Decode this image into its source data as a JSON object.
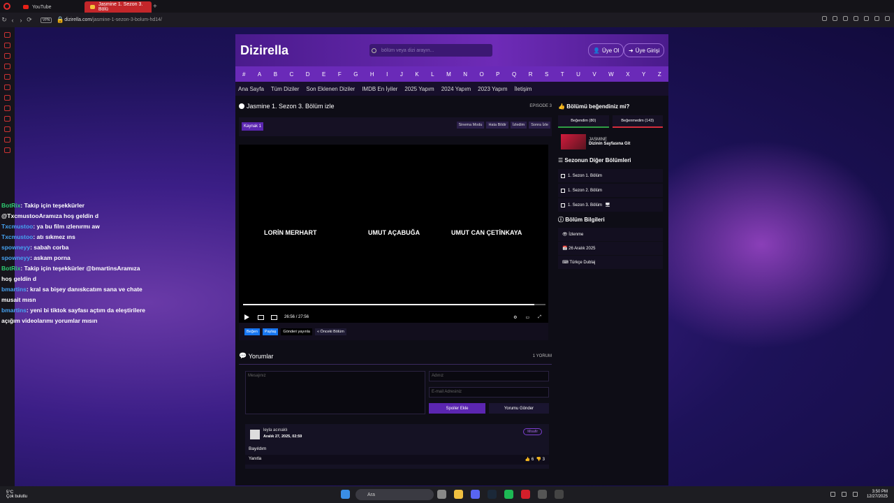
{
  "browser": {
    "tabs": [
      {
        "title": "YouTube"
      },
      {
        "title": "Jasmine 1. Sezon 3. Bölü"
      }
    ],
    "url_domain": "dizirella.com",
    "url_path": "/jasmine-1-sezon-3-bolum-hd14/",
    "vpn": "VPN"
  },
  "site": {
    "logo": "Dizirella",
    "search_placeholder": "bölüm veya dizi arayın...",
    "register": "Üye Ol",
    "login": "Üye Girişi",
    "alphabet": [
      "#",
      "A",
      "B",
      "C",
      "D",
      "E",
      "F",
      "G",
      "H",
      "I",
      "J",
      "K",
      "L",
      "M",
      "N",
      "O",
      "P",
      "Q",
      "R",
      "S",
      "T",
      "U",
      "V",
      "W",
      "X",
      "Y",
      "Z"
    ],
    "menu": [
      "Ana Sayfa",
      "Tüm Diziler",
      "Son Eklenen Diziler",
      "IMDB En İyiler",
      "2025 Yapım",
      "2024 Yapım",
      "2023 Yapım",
      "İletişim"
    ]
  },
  "episode": {
    "title": "Jasmine 1. Sezon 3. Bölüm izle",
    "label": "EPISODE 3",
    "source": "Kaynak 1",
    "buttons": [
      "Sinema Modu",
      "Hata Bildir",
      "İzledim",
      "Sonra İzle"
    ]
  },
  "player": {
    "credits": [
      "LORİN MERHART",
      "UMUT AÇABUĞA",
      "UMUT CAN ÇETİNKAYA"
    ],
    "current_time": "26:56",
    "duration": "27:56",
    "separator": "/",
    "progress": 0.964
  },
  "share": {
    "like": "Beğen",
    "fb_share": "Paylaş",
    "tweet": "Gönderi yayınla",
    "prev": "« Önceki Bölüm"
  },
  "comments": {
    "header": "Yorumlar",
    "count": "1 YORUM",
    "message_placeholder": "Mesajınız",
    "name_placeholder": "Adınız",
    "email_placeholder": "E-mail Adresiniz",
    "spoiler": "Spoiler Ekle",
    "submit": "Yorumu Gönder",
    "items": [
      {
        "name": "leyla acınaklı",
        "date": "Aralık 27, 2025, 02:59",
        "badge": "Misafir",
        "text": "Bayıldım",
        "reply": "Yanıtla",
        "likes": "6",
        "dislikes": "3"
      }
    ]
  },
  "sidebar": {
    "like_header": "Bölümü beğendiniz mi?",
    "liked": "Beğendim (80)",
    "disliked": "Beğenmedim (143)",
    "show_name": "JASMINE",
    "show_link": "Dizinin Sayfasına Git",
    "episodes_header": "Sezonun Diğer Bölümleri",
    "episodes": [
      "1. Sezon 1. Bölüm",
      "1. Sezon 2. Bölüm",
      "1. Sezon 3. Bölüm"
    ],
    "info_header": "Bölüm Bilgileri",
    "info": [
      "İzlenme",
      "26 Aralık 2025",
      "Türkçe Dublaj"
    ]
  },
  "chat": [
    {
      "user": "BotRix",
      "text": ": Takip için teşekkürler"
    },
    {
      "user": "",
      "text": "@TxcmustooAramıza hoş geldin d"
    },
    {
      "user": "Txcmustoo",
      "text": ": ya bu film ızlenırmı aw"
    },
    {
      "user": "Txcmustoo",
      "text": ": atı sıkmez ıns"
    },
    {
      "user": "spowneyy",
      "text": ": sabah corba"
    },
    {
      "user": "spowneyy",
      "text": ": askam porna"
    },
    {
      "user": "BotRix",
      "text": ": Takip için teşekkürler @bmartinsAramıza"
    },
    {
      "user": "",
      "text": "hoş geldin d"
    },
    {
      "user": "bmartins",
      "text": ": kral sa bişey danıskcatım sana ve chate"
    },
    {
      "user": "",
      "text": "musait mısn"
    },
    {
      "user": "bmartins",
      "text": ": yeni bi tiktok sayfası açtım da eleştirilere"
    },
    {
      "user": "",
      "text": "açığım videolarımı yorumlar mısın"
    }
  ],
  "taskbar": {
    "temp": "5°C",
    "weather": "Çok bulutlu",
    "search": "Ara",
    "time": "3:50 PM",
    "date": "12/27/2025"
  }
}
